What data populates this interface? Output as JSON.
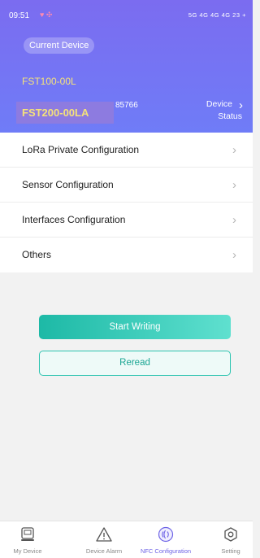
{
  "status_bar": {
    "time": "09:51",
    "indicators": "♥ ✣",
    "right": "5G 4G 4G 4G 23 +"
  },
  "header": {
    "current_device_label": "Current Device",
    "device_codes": [
      "FST100-00L",
      "FST200-00LA"
    ],
    "serial_fragment": "85766",
    "status_button": {
      "line1": "Device",
      "line2": "Status"
    }
  },
  "menu": {
    "items": [
      {
        "label": "LoRa Private Configuration"
      },
      {
        "label": "Sensor Configuration"
      },
      {
        "label": "Interfaces Configuration"
      },
      {
        "label": "Others"
      }
    ]
  },
  "actions": {
    "start_writing": "Start Writing",
    "reread": "Reread"
  },
  "tabbar": {
    "tabs": [
      {
        "label": "My Device",
        "icon": "device-icon"
      },
      {
        "label": "Device Alarm",
        "icon": "warning-icon"
      },
      {
        "label": "NFC Configuration",
        "icon": "nfc-icon",
        "active": true
      },
      {
        "label": "Setting",
        "icon": "gear-icon"
      }
    ]
  },
  "colors": {
    "header_gradient_top": "#7b6cf0",
    "header_gradient_bottom": "#6f7cf7",
    "accent_yellow": "#f5e27a",
    "accent_teal": "#1db9a6",
    "active_tab": "#6d63e6"
  }
}
